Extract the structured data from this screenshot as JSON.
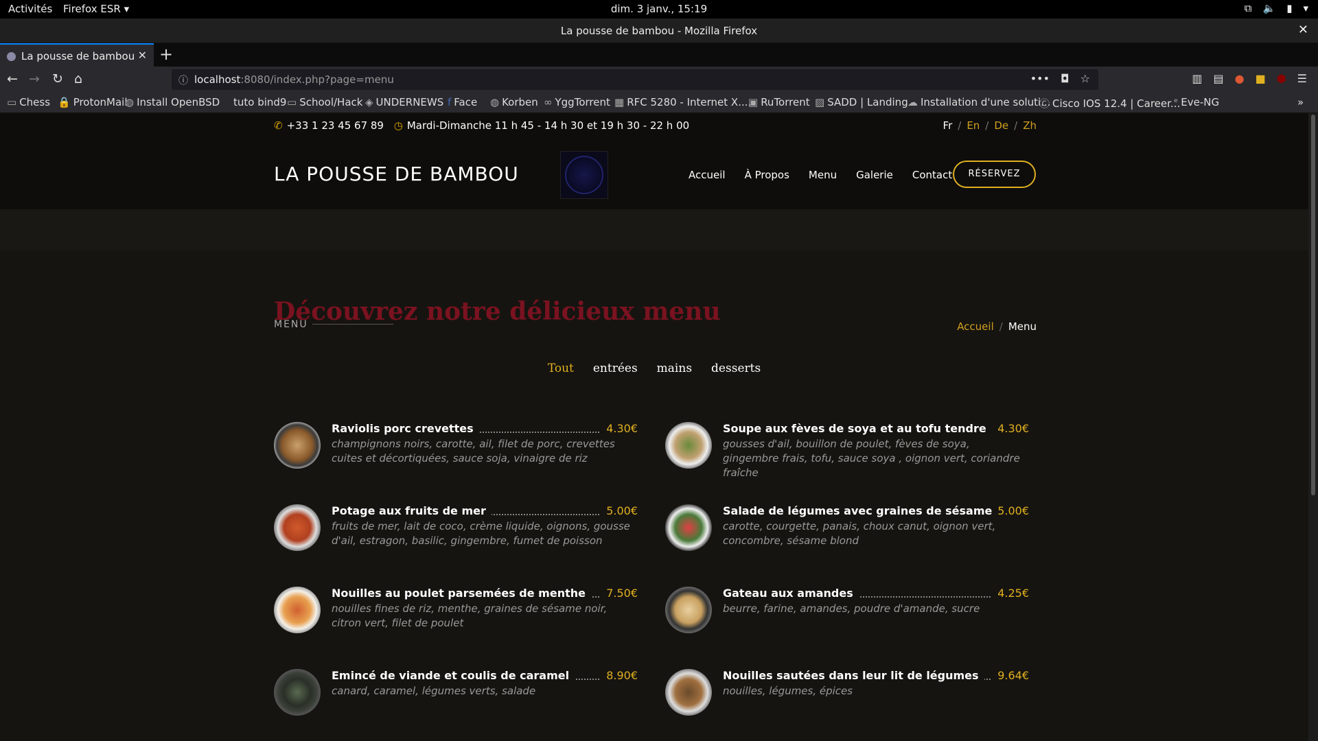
{
  "os": {
    "activities": "Activités",
    "app": "Firefox ESR ▾",
    "clock": "dim.  3 janv., 15:19"
  },
  "window": {
    "title": "La pousse de bambou - Mozilla Firefox"
  },
  "tab": {
    "label": "La pousse de bambou"
  },
  "url": {
    "host": "localhost",
    "path": ":8080/index.php?page=menu"
  },
  "bookmarks": [
    "Chess",
    "ProtonMail",
    "Install OpenBSD",
    "tuto bind9",
    "School/Hack",
    "UNDERNEWS",
    "Face",
    "Korben",
    "YggTorrent",
    "RFC 5280 - Internet X....",
    "RuTorrent",
    "SADD | Landing",
    "Installation d'une soluti...",
    "Cisco IOS 12.4 | Career...",
    "Eve-NG"
  ],
  "site": {
    "phone": "+33 1 23 45 67 89",
    "hours": "Mardi-Dimanche 11 h 45 - 14 h 30 et 19 h 30 - 22 h 00",
    "langs": [
      "Fr",
      "En",
      "De",
      "Zh"
    ],
    "brand": "LA POUSSE DE BAMBOU",
    "nav": [
      "Accueil",
      "À Propos",
      "Menu",
      "Galerie",
      "Contact"
    ],
    "reserve": "RÉSERVEZ",
    "section_label": "MENU",
    "breadcrumb": {
      "home": "Accueil",
      "current": "Menu"
    },
    "heading": "Découvrez notre délicieux menu",
    "filters": [
      "Tout",
      "entrées",
      "mains",
      "desserts"
    ]
  },
  "menu_items": [
    {
      "name": "Raviolis porc crevettes",
      "price": "4.30€",
      "desc": "champignons noirs, carotte, ail, filet de porc, crevettes cuites et décortiquées, sauce soja, vinaigre de riz"
    },
    {
      "name": "Soupe aux fèves de soya et au tofu tendre",
      "price": "4.30€",
      "desc": "gousses d'ail, bouillon de poulet, fèves de soya, gingembre frais, tofu, sauce soya , oignon vert, coriandre fraîche"
    },
    {
      "name": "Potage aux fruits de mer",
      "price": "5.00€",
      "desc": "fruits de mer, lait de coco, crème liquide, oignons, gousse d'ail, estragon, basilic, gingembre, fumet de poisson"
    },
    {
      "name": "Salade de légumes avec graines de sésame",
      "price": "5.00€",
      "desc": "carotte, courgette, panais, choux canut, oignon vert, concombre, sésame blond"
    },
    {
      "name": "Nouilles au poulet parsemées de menthe",
      "price": "7.50€",
      "desc": "nouilles fines de riz, menthe, graines de sésame noir, citron vert, filet de poulet"
    },
    {
      "name": "Gateau aux amandes",
      "price": "4.25€",
      "desc": "beurre, farine, amandes, poudre d'amande, sucre"
    },
    {
      "name": "Emincé de viande et coulis de caramel",
      "price": "8.90€",
      "desc": "canard, caramel, légumes verts, salade"
    },
    {
      "name": "Nouilles sautées dans leur lit de légumes",
      "price": "9.64€",
      "desc": "nouilles, légumes, épices"
    }
  ]
}
